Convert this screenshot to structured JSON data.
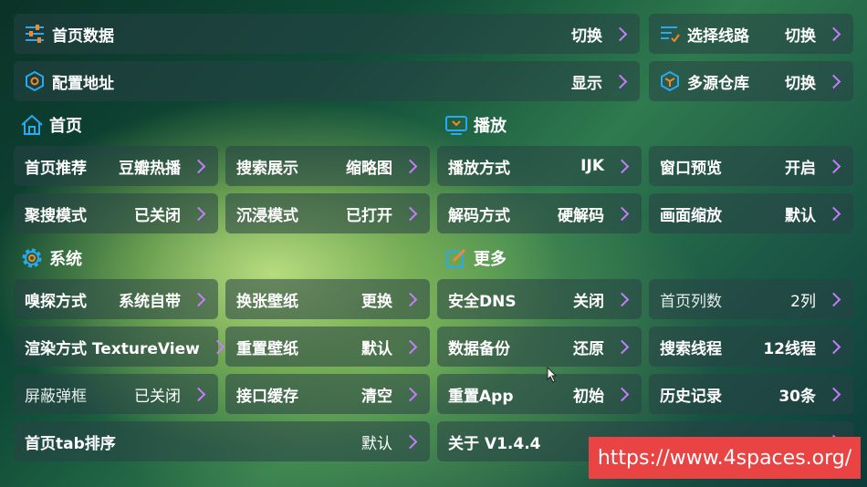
{
  "top": {
    "home_data": {
      "label": "首页数据",
      "value": "切换",
      "icon": "sliders-icon"
    },
    "select_route": {
      "label": "选择线路",
      "value": "切换",
      "icon": "list-icon"
    },
    "config_address": {
      "label": "配置地址",
      "value": "显示",
      "icon": "hexagon-icon"
    },
    "multi_source": {
      "label": "多源仓库",
      "value": "切换",
      "icon": "cube-icon"
    }
  },
  "sections": {
    "home": "首页",
    "play": "播放",
    "system": "系统",
    "more": "更多"
  },
  "home": {
    "recommend": {
      "label": "首页推荐",
      "value": "豆瓣热播"
    },
    "search_display": {
      "label": "搜索展示",
      "value": "缩略图"
    },
    "aggregate_search": {
      "label": "聚搜模式",
      "value": "已关闭"
    },
    "immersive": {
      "label": "沉浸模式",
      "value": "已打开"
    }
  },
  "play": {
    "play_mode": {
      "label": "播放方式",
      "value": "IJK"
    },
    "window_preview": {
      "label": "窗口预览",
      "value": "开启"
    },
    "decode_mode": {
      "label": "解码方式",
      "value": "硬解码"
    },
    "screen_scale": {
      "label": "画面缩放",
      "value": "默认"
    }
  },
  "system": {
    "sniff_mode": {
      "label": "嗅探方式",
      "value": "系统自带"
    },
    "change_wallpaper": {
      "label": "换张壁纸",
      "value": "更换"
    },
    "render_mode": {
      "label": "渲染方式 TextureView",
      "value": ""
    },
    "reset_wallpaper": {
      "label": "重置壁纸",
      "value": "默认"
    },
    "block_popup": {
      "label": "屏蔽弹框",
      "value": "已关闭"
    },
    "api_cache": {
      "label": "接口缓存",
      "value": "清空"
    },
    "tab_sort": {
      "label": "首页tab排序",
      "value": "默认"
    }
  },
  "more": {
    "secure_dns": {
      "label": "安全DNS",
      "value": "关闭"
    },
    "home_columns": {
      "label": "首页列数",
      "value": "2列"
    },
    "data_backup": {
      "label": "数据备份",
      "value": "还原"
    },
    "search_threads": {
      "label": "搜索线程",
      "value": "12线程"
    },
    "reset_app": {
      "label": "重置App",
      "value": "初始"
    },
    "history": {
      "label": "历史记录",
      "value": "30条"
    },
    "about": {
      "label": "关于 V1.4.4",
      "value": ""
    }
  },
  "watermark": "https://www.4spaces.org/",
  "colors": {
    "accent_chevron": "#c97bff",
    "icon_orange": "#f08a2c",
    "icon_blue": "#2aa8f0",
    "banner": "#e94343"
  }
}
